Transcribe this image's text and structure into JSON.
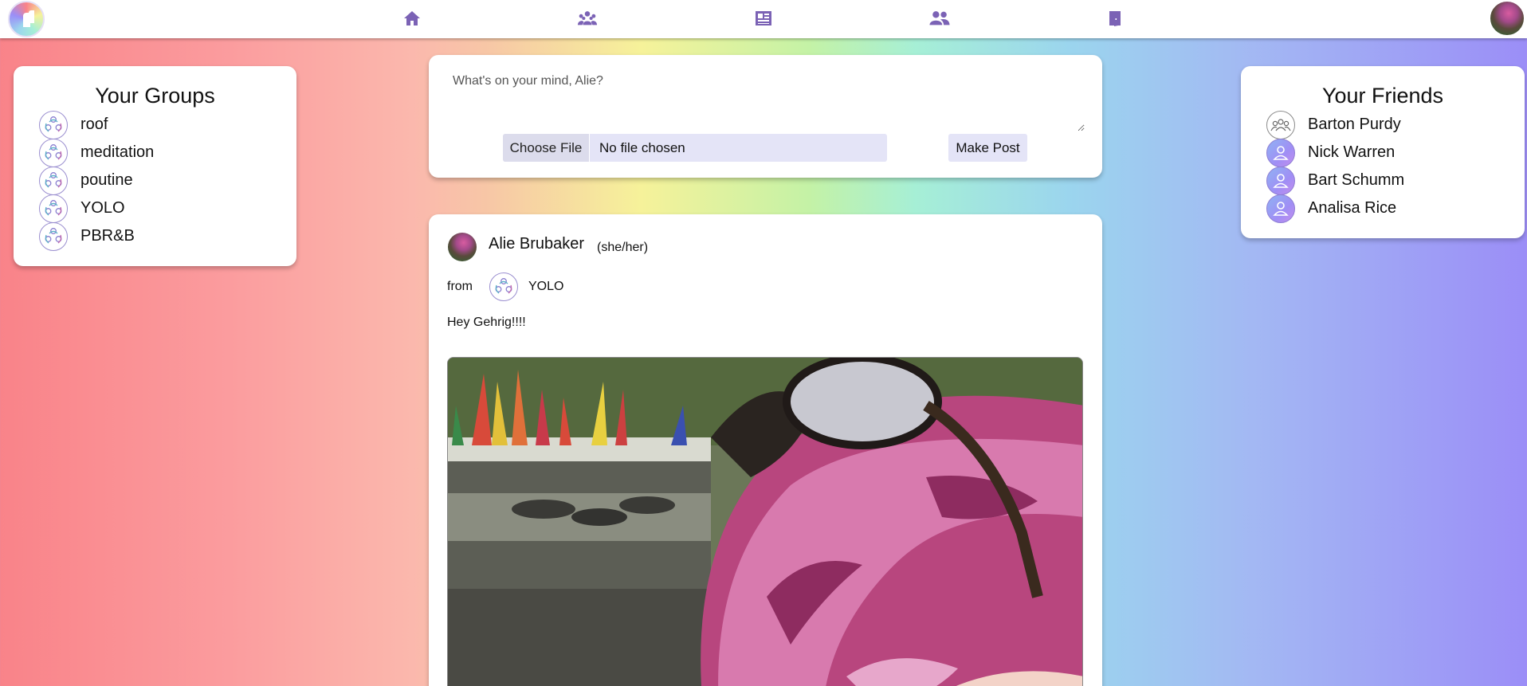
{
  "nav": {
    "items": [
      {
        "name": "home-icon"
      },
      {
        "name": "groups-icon"
      },
      {
        "name": "newsfeed-icon"
      },
      {
        "name": "friends-icon"
      },
      {
        "name": "logout-icon"
      }
    ],
    "accent_color": "#7b62b5"
  },
  "groups": {
    "title": "Your Groups",
    "items": [
      {
        "label": "roof"
      },
      {
        "label": "meditation"
      },
      {
        "label": "poutine"
      },
      {
        "label": "YOLO"
      },
      {
        "label": "PBR&B"
      }
    ]
  },
  "friends": {
    "title": "Your Friends",
    "items": [
      {
        "label": "Barton Purdy"
      },
      {
        "label": "Nick Warren"
      },
      {
        "label": "Bart Schumm"
      },
      {
        "label": "Analisa Rice"
      }
    ]
  },
  "composer": {
    "placeholder": "What's on your mind, Alie?",
    "choose_file_label": "Choose File",
    "no_file_label": "No file chosen",
    "make_post_label": "Make Post"
  },
  "post": {
    "author": "Alie Brubaker",
    "pronouns": "(she/her)",
    "from_label": "from",
    "group": "YOLO",
    "text": "Hey Gehrig!!!!"
  }
}
